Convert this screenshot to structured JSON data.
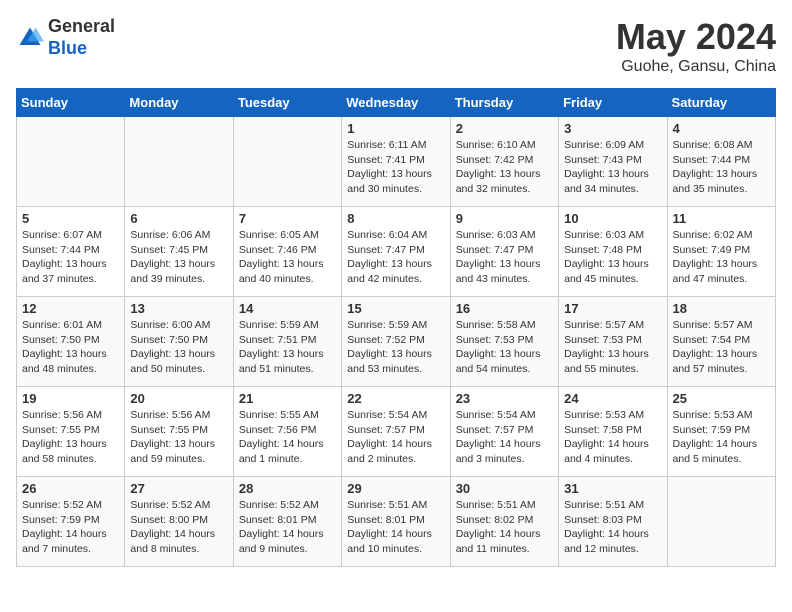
{
  "header": {
    "logo_general": "General",
    "logo_blue": "Blue",
    "month_year": "May 2024",
    "location": "Guohe, Gansu, China"
  },
  "days_of_week": [
    "Sunday",
    "Monday",
    "Tuesday",
    "Wednesday",
    "Thursday",
    "Friday",
    "Saturday"
  ],
  "weeks": [
    [
      {
        "day": "",
        "content": ""
      },
      {
        "day": "",
        "content": ""
      },
      {
        "day": "",
        "content": ""
      },
      {
        "day": "1",
        "content": "Sunrise: 6:11 AM\nSunset: 7:41 PM\nDaylight: 13 hours\nand 30 minutes."
      },
      {
        "day": "2",
        "content": "Sunrise: 6:10 AM\nSunset: 7:42 PM\nDaylight: 13 hours\nand 32 minutes."
      },
      {
        "day": "3",
        "content": "Sunrise: 6:09 AM\nSunset: 7:43 PM\nDaylight: 13 hours\nand 34 minutes."
      },
      {
        "day": "4",
        "content": "Sunrise: 6:08 AM\nSunset: 7:44 PM\nDaylight: 13 hours\nand 35 minutes."
      }
    ],
    [
      {
        "day": "5",
        "content": "Sunrise: 6:07 AM\nSunset: 7:44 PM\nDaylight: 13 hours\nand 37 minutes."
      },
      {
        "day": "6",
        "content": "Sunrise: 6:06 AM\nSunset: 7:45 PM\nDaylight: 13 hours\nand 39 minutes."
      },
      {
        "day": "7",
        "content": "Sunrise: 6:05 AM\nSunset: 7:46 PM\nDaylight: 13 hours\nand 40 minutes."
      },
      {
        "day": "8",
        "content": "Sunrise: 6:04 AM\nSunset: 7:47 PM\nDaylight: 13 hours\nand 42 minutes."
      },
      {
        "day": "9",
        "content": "Sunrise: 6:03 AM\nSunset: 7:47 PM\nDaylight: 13 hours\nand 43 minutes."
      },
      {
        "day": "10",
        "content": "Sunrise: 6:03 AM\nSunset: 7:48 PM\nDaylight: 13 hours\nand 45 minutes."
      },
      {
        "day": "11",
        "content": "Sunrise: 6:02 AM\nSunset: 7:49 PM\nDaylight: 13 hours\nand 47 minutes."
      }
    ],
    [
      {
        "day": "12",
        "content": "Sunrise: 6:01 AM\nSunset: 7:50 PM\nDaylight: 13 hours\nand 48 minutes."
      },
      {
        "day": "13",
        "content": "Sunrise: 6:00 AM\nSunset: 7:50 PM\nDaylight: 13 hours\nand 50 minutes."
      },
      {
        "day": "14",
        "content": "Sunrise: 5:59 AM\nSunset: 7:51 PM\nDaylight: 13 hours\nand 51 minutes."
      },
      {
        "day": "15",
        "content": "Sunrise: 5:59 AM\nSunset: 7:52 PM\nDaylight: 13 hours\nand 53 minutes."
      },
      {
        "day": "16",
        "content": "Sunrise: 5:58 AM\nSunset: 7:53 PM\nDaylight: 13 hours\nand 54 minutes."
      },
      {
        "day": "17",
        "content": "Sunrise: 5:57 AM\nSunset: 7:53 PM\nDaylight: 13 hours\nand 55 minutes."
      },
      {
        "day": "18",
        "content": "Sunrise: 5:57 AM\nSunset: 7:54 PM\nDaylight: 13 hours\nand 57 minutes."
      }
    ],
    [
      {
        "day": "19",
        "content": "Sunrise: 5:56 AM\nSunset: 7:55 PM\nDaylight: 13 hours\nand 58 minutes."
      },
      {
        "day": "20",
        "content": "Sunrise: 5:56 AM\nSunset: 7:55 PM\nDaylight: 13 hours\nand 59 minutes."
      },
      {
        "day": "21",
        "content": "Sunrise: 5:55 AM\nSunset: 7:56 PM\nDaylight: 14 hours\nand 1 minute."
      },
      {
        "day": "22",
        "content": "Sunrise: 5:54 AM\nSunset: 7:57 PM\nDaylight: 14 hours\nand 2 minutes."
      },
      {
        "day": "23",
        "content": "Sunrise: 5:54 AM\nSunset: 7:57 PM\nDaylight: 14 hours\nand 3 minutes."
      },
      {
        "day": "24",
        "content": "Sunrise: 5:53 AM\nSunset: 7:58 PM\nDaylight: 14 hours\nand 4 minutes."
      },
      {
        "day": "25",
        "content": "Sunrise: 5:53 AM\nSunset: 7:59 PM\nDaylight: 14 hours\nand 5 minutes."
      }
    ],
    [
      {
        "day": "26",
        "content": "Sunrise: 5:52 AM\nSunset: 7:59 PM\nDaylight: 14 hours\nand 7 minutes."
      },
      {
        "day": "27",
        "content": "Sunrise: 5:52 AM\nSunset: 8:00 PM\nDaylight: 14 hours\nand 8 minutes."
      },
      {
        "day": "28",
        "content": "Sunrise: 5:52 AM\nSunset: 8:01 PM\nDaylight: 14 hours\nand 9 minutes."
      },
      {
        "day": "29",
        "content": "Sunrise: 5:51 AM\nSunset: 8:01 PM\nDaylight: 14 hours\nand 10 minutes."
      },
      {
        "day": "30",
        "content": "Sunrise: 5:51 AM\nSunset: 8:02 PM\nDaylight: 14 hours\nand 11 minutes."
      },
      {
        "day": "31",
        "content": "Sunrise: 5:51 AM\nSunset: 8:03 PM\nDaylight: 14 hours\nand 12 minutes."
      },
      {
        "day": "",
        "content": ""
      }
    ]
  ]
}
